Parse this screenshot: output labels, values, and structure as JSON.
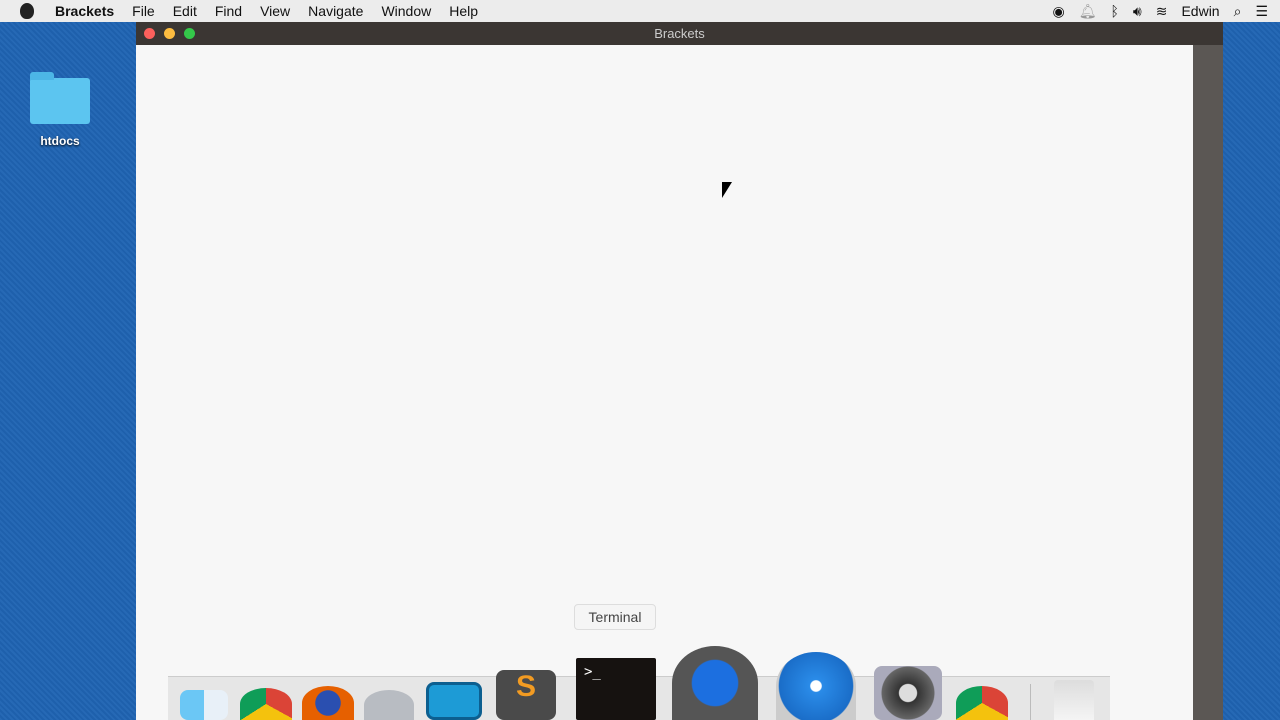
{
  "menubar": {
    "app": "Brackets",
    "items": [
      "File",
      "Edit",
      "Find",
      "View",
      "Navigate",
      "Window",
      "Help"
    ],
    "user": "Edwin"
  },
  "desktop": {
    "folder": "htdocs"
  },
  "window": {
    "title": "Brackets"
  },
  "dock": {
    "tooltip": "Terminal",
    "apps": [
      "Finder",
      "Chrome",
      "Firefox",
      "Launchpad",
      "Brackets",
      "Sublime Text",
      "Terminal",
      "QuickTime Player",
      "Safari",
      "System Preferences",
      "Chrome",
      "Trash"
    ]
  }
}
